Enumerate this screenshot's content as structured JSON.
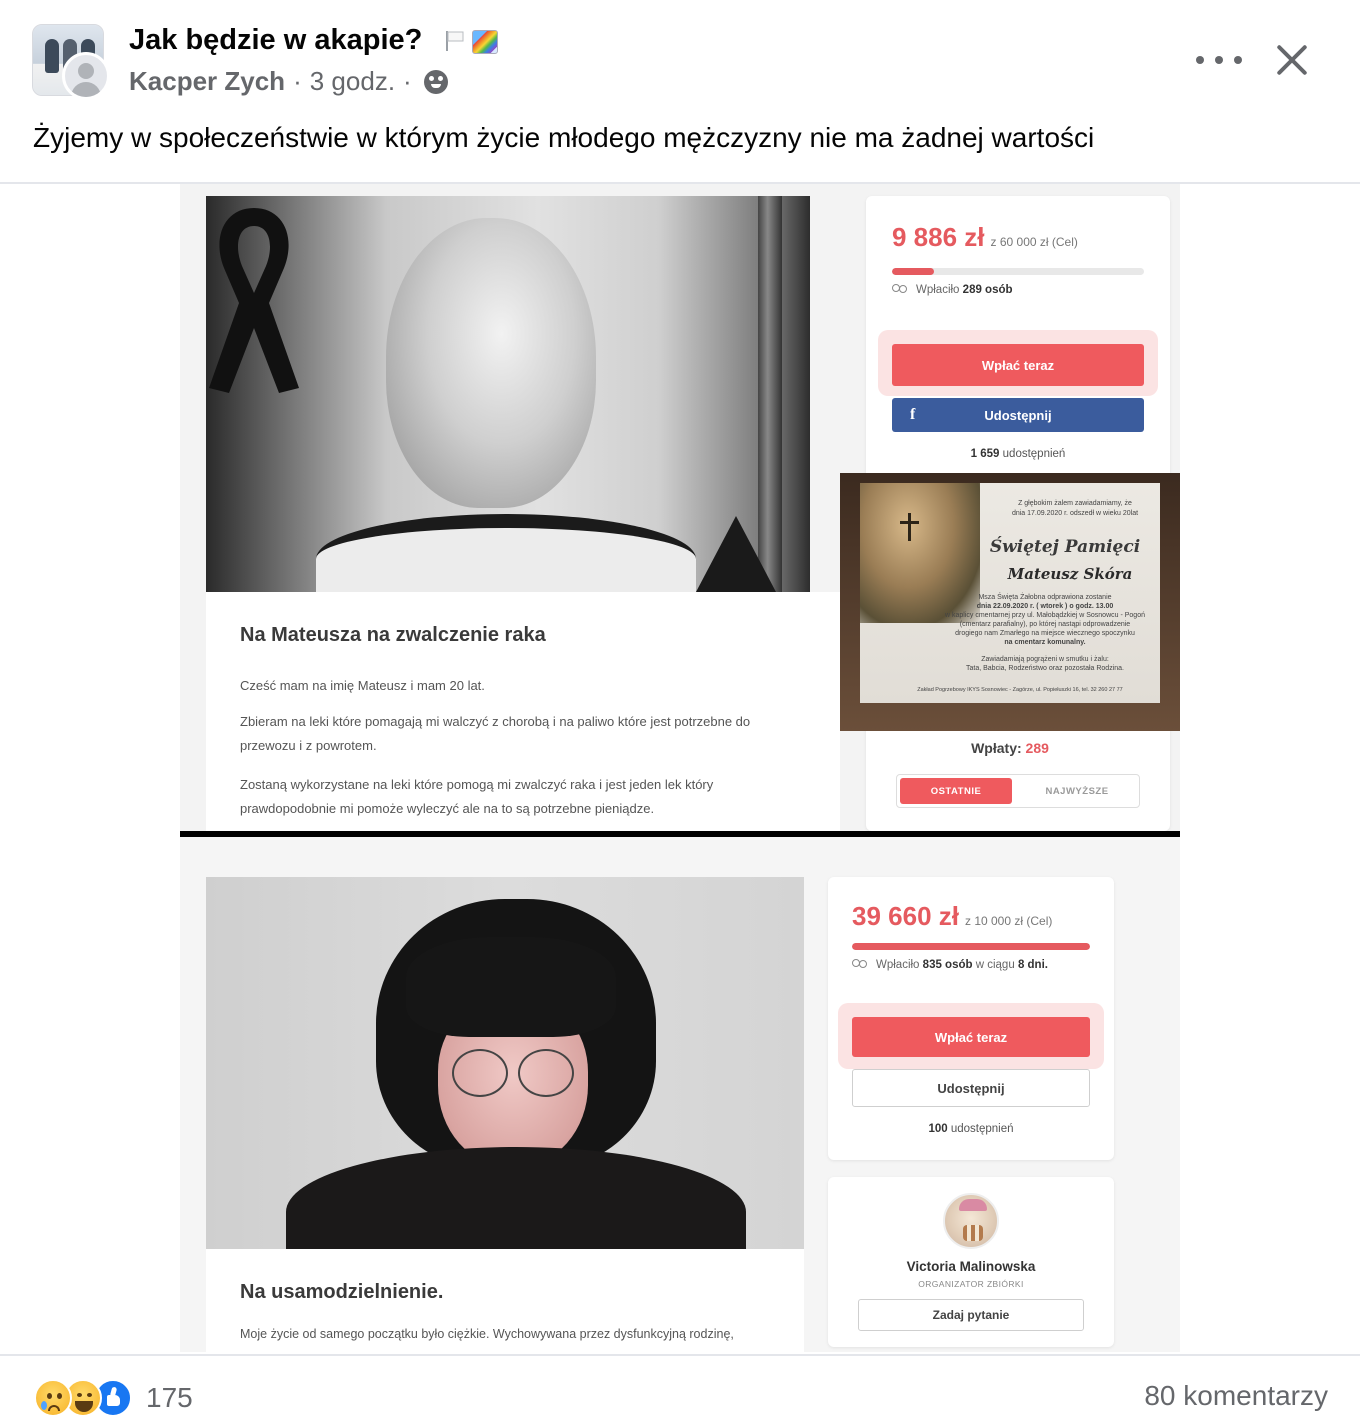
{
  "post": {
    "group_name": "Jak będzie w akapie?",
    "author": "Kacper Zych",
    "time": "3 godz.",
    "separator": "·",
    "audience_icon": "group-audience-icon",
    "text": "Żyjemy w społeczeństwie w którym życie młodego mężczyzny nie ma żadnej wartości",
    "title_emojis": [
      "white-flag-icon",
      "rainbow-icon"
    ]
  },
  "image": {
    "top": {
      "campaign_title": "Na Mateusza na zwalczenie raka",
      "paragraphs": [
        "Cześć mam na imię Mateusz i mam 20 lat.",
        "Zbieram na leki które pomagają mi walczyć z chorobą i na paliwo które jest potrzebne do",
        "przewozu i z powrotem.",
        "Zostaną wykorzystane na leki które pomogą mi zwalczyć raka i jest jeden lek który",
        "prawdopodobnie mi pomoże wyleczyć ale na to są potrzebne pieniądze."
      ],
      "raised": "9 886 zł",
      "goal": "z 60 000 zł (Cel)",
      "progress": 0.165,
      "donors_prefix": "Wpłaciło",
      "donors_count": "289 osób",
      "donate_label": "Wpłać teraz",
      "share_label": "Udostępnij",
      "shares_count": "1 659",
      "shares_suffix": "udostępnień",
      "payments_label": "Wpłaty:",
      "payments_count": "289",
      "tab_latest": "OSTATNIE",
      "tab_highest": "NAJWYŻSZE",
      "obituary": {
        "intro_1": "Z głębokim żalem zawiadamiamy, że",
        "intro_2": "dnia 17.09.2020 r. odszedł w wieku 20lat",
        "heading": "Świętej Pamięci",
        "name": "Mateusz Skóra",
        "mass_1": "Msza Święta Żałobna odprawiona zostanie",
        "mass_2": "dnia 22.09.2020 r. ( wtorek ) o godz. 13.00",
        "mass_3": "w kaplicy cmentarnej przy ul. Małobądzkiej w Sosnowcu - Pogoń",
        "mass_4": "(cmentarz parafialny), po której nastąpi odprowadzenie",
        "mass_5": "drogiego nam Zmarłego na miejsce wiecznego spoczynku",
        "mass_6": "na cmentarz komunalny.",
        "family_1": "Zawiadamiają pogrążeni w smutku i żalu:",
        "family_2": "Tata, Babcia, Rodzeństwo oraz pozostała Rodzina.",
        "footer": "Zakład Pogrzebowy IKYS Sosnowiec - Zagórze, ul. Popiełuszki 16, tel. 32 260 27 77"
      }
    },
    "bottom": {
      "campaign_title": "Na usamodzielnienie.",
      "paragraph": "Moje życie od samego początku było ciężkie. Wychowywana przez dysfunkcyjną rodzinę,",
      "raised": "39 660 zł",
      "goal": "z 10 000 zł (Cel)",
      "progress": 1.0,
      "donors_prefix": "Wpłaciło",
      "donors_count": "835 osób",
      "donors_mid": "w ciągu",
      "donors_days": "8 dni.",
      "donate_label": "Wpłać teraz",
      "share_label": "Udostępnij",
      "shares_count": "100",
      "shares_suffix": "udostępnień",
      "organizer_name": "Victoria Malinowska",
      "organizer_role": "ORGANIZATOR ZBIÓRKI",
      "ask_label": "Zadaj pytanie"
    }
  },
  "footer": {
    "reactions": [
      "sad-reaction-icon",
      "haha-reaction-icon",
      "like-reaction-icon"
    ],
    "reaction_count": "175",
    "comments": "80 komentarzy"
  },
  "colors": {
    "accent_red": "#ef5a5e",
    "facebook_blue": "#3b5c9d",
    "meta_gray": "#65676b"
  }
}
